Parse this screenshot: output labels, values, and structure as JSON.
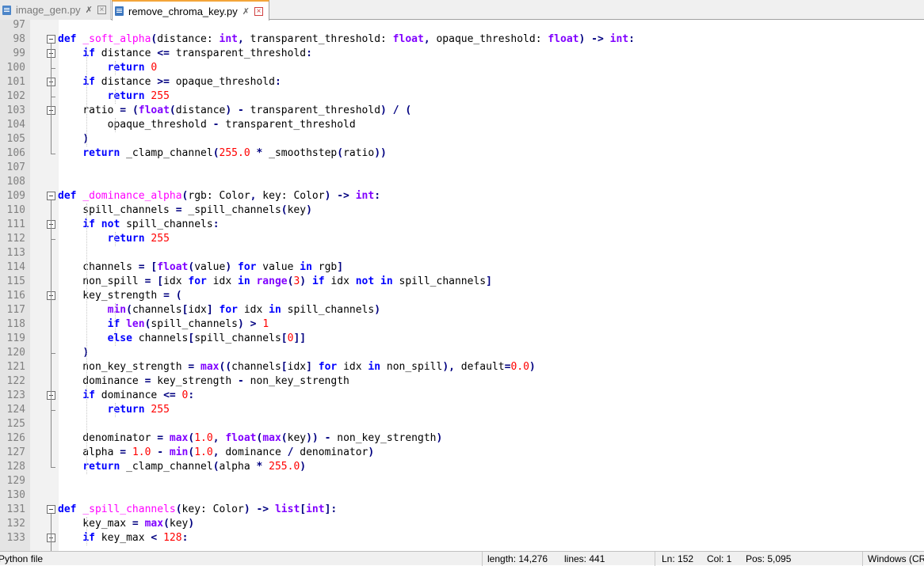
{
  "tabs": [
    {
      "label": "image_gen.py",
      "active": false
    },
    {
      "label": "remove_chroma_key.py",
      "active": true
    }
  ],
  "colors": {
    "keyword": "#0000ff",
    "builtin": "#8000ff",
    "function_name": "#ff00ff",
    "number": "#ff0000",
    "operator": "#000080"
  },
  "code_lines": [
    {
      "n": "97",
      "tokens": []
    },
    {
      "n": "98",
      "tokens": [
        [
          "kw",
          "def"
        ],
        [
          "t",
          " "
        ],
        [
          "fn",
          "_soft_alpha"
        ],
        [
          "op",
          "("
        ],
        [
          "t",
          "distance: "
        ],
        [
          "kw2",
          "int"
        ],
        [
          "op",
          ","
        ],
        [
          "t",
          " transparent_threshold: "
        ],
        [
          "kw2",
          "float"
        ],
        [
          "op",
          ","
        ],
        [
          "t",
          " opaque_threshold: "
        ],
        [
          "kw2",
          "float"
        ],
        [
          "op",
          ")"
        ],
        [
          "t",
          " "
        ],
        [
          "op",
          "->"
        ],
        [
          "t",
          " "
        ],
        [
          "kw2",
          "int"
        ],
        [
          "op",
          ":"
        ]
      ]
    },
    {
      "n": "99",
      "tokens": [
        [
          "t",
          "    "
        ],
        [
          "kw",
          "if"
        ],
        [
          "t",
          " distance "
        ],
        [
          "op",
          "<="
        ],
        [
          "t",
          " transparent_threshold"
        ],
        [
          "op",
          ":"
        ]
      ]
    },
    {
      "n": "100",
      "tokens": [
        [
          "t",
          "        "
        ],
        [
          "kw",
          "return"
        ],
        [
          "t",
          " "
        ],
        [
          "num",
          "0"
        ]
      ]
    },
    {
      "n": "101",
      "tokens": [
        [
          "t",
          "    "
        ],
        [
          "kw",
          "if"
        ],
        [
          "t",
          " distance "
        ],
        [
          "op",
          ">="
        ],
        [
          "t",
          " opaque_threshold"
        ],
        [
          "op",
          ":"
        ]
      ]
    },
    {
      "n": "102",
      "tokens": [
        [
          "t",
          "        "
        ],
        [
          "kw",
          "return"
        ],
        [
          "t",
          " "
        ],
        [
          "num",
          "255"
        ]
      ]
    },
    {
      "n": "103",
      "tokens": [
        [
          "t",
          "    ratio "
        ],
        [
          "op",
          "="
        ],
        [
          "t",
          " "
        ],
        [
          "op",
          "("
        ],
        [
          "kw2",
          "float"
        ],
        [
          "op",
          "("
        ],
        [
          "t",
          "distance"
        ],
        [
          "op",
          ")"
        ],
        [
          "t",
          " "
        ],
        [
          "op",
          "-"
        ],
        [
          "t",
          " transparent_threshold"
        ],
        [
          "op",
          ")"
        ],
        [
          "t",
          " "
        ],
        [
          "op",
          "/"
        ],
        [
          "t",
          " "
        ],
        [
          "op",
          "("
        ]
      ]
    },
    {
      "n": "104",
      "tokens": [
        [
          "t",
          "        opaque_threshold "
        ],
        [
          "op",
          "-"
        ],
        [
          "t",
          " transparent_threshold"
        ]
      ]
    },
    {
      "n": "105",
      "tokens": [
        [
          "t",
          "    "
        ],
        [
          "op",
          ")"
        ]
      ]
    },
    {
      "n": "106",
      "tokens": [
        [
          "t",
          "    "
        ],
        [
          "kw",
          "return"
        ],
        [
          "t",
          " _clamp_channel"
        ],
        [
          "op",
          "("
        ],
        [
          "num",
          "255.0"
        ],
        [
          "t",
          " "
        ],
        [
          "op",
          "*"
        ],
        [
          "t",
          " _smoothstep"
        ],
        [
          "op",
          "("
        ],
        [
          "t",
          "ratio"
        ],
        [
          "op",
          "))"
        ]
      ]
    },
    {
      "n": "107",
      "tokens": []
    },
    {
      "n": "108",
      "tokens": []
    },
    {
      "n": "109",
      "tokens": [
        [
          "kw",
          "def"
        ],
        [
          "t",
          " "
        ],
        [
          "fn",
          "_dominance_alpha"
        ],
        [
          "op",
          "("
        ],
        [
          "t",
          "rgb: Color"
        ],
        [
          "op",
          ","
        ],
        [
          "t",
          " key: Color"
        ],
        [
          "op",
          ")"
        ],
        [
          "t",
          " "
        ],
        [
          "op",
          "->"
        ],
        [
          "t",
          " "
        ],
        [
          "kw2",
          "int"
        ],
        [
          "op",
          ":"
        ]
      ]
    },
    {
      "n": "110",
      "tokens": [
        [
          "t",
          "    spill_channels "
        ],
        [
          "op",
          "="
        ],
        [
          "t",
          " _spill_channels"
        ],
        [
          "op",
          "("
        ],
        [
          "t",
          "key"
        ],
        [
          "op",
          ")"
        ]
      ]
    },
    {
      "n": "111",
      "tokens": [
        [
          "t",
          "    "
        ],
        [
          "kw",
          "if"
        ],
        [
          "t",
          " "
        ],
        [
          "kw",
          "not"
        ],
        [
          "t",
          " spill_channels"
        ],
        [
          "op",
          ":"
        ]
      ]
    },
    {
      "n": "112",
      "tokens": [
        [
          "t",
          "        "
        ],
        [
          "kw",
          "return"
        ],
        [
          "t",
          " "
        ],
        [
          "num",
          "255"
        ]
      ]
    },
    {
      "n": "113",
      "tokens": []
    },
    {
      "n": "114",
      "tokens": [
        [
          "t",
          "    channels "
        ],
        [
          "op",
          "="
        ],
        [
          "t",
          " "
        ],
        [
          "op",
          "["
        ],
        [
          "kw2",
          "float"
        ],
        [
          "op",
          "("
        ],
        [
          "t",
          "value"
        ],
        [
          "op",
          ")"
        ],
        [
          "t",
          " "
        ],
        [
          "kw",
          "for"
        ],
        [
          "t",
          " value "
        ],
        [
          "kw",
          "in"
        ],
        [
          "t",
          " rgb"
        ],
        [
          "op",
          "]"
        ]
      ]
    },
    {
      "n": "115",
      "tokens": [
        [
          "t",
          "    non_spill "
        ],
        [
          "op",
          "="
        ],
        [
          "t",
          " "
        ],
        [
          "op",
          "["
        ],
        [
          "t",
          "idx "
        ],
        [
          "kw",
          "for"
        ],
        [
          "t",
          " idx "
        ],
        [
          "kw",
          "in"
        ],
        [
          "t",
          " "
        ],
        [
          "kw2",
          "range"
        ],
        [
          "op",
          "("
        ],
        [
          "num",
          "3"
        ],
        [
          "op",
          ")"
        ],
        [
          "t",
          " "
        ],
        [
          "kw",
          "if"
        ],
        [
          "t",
          " idx "
        ],
        [
          "kw",
          "not"
        ],
        [
          "t",
          " "
        ],
        [
          "kw",
          "in"
        ],
        [
          "t",
          " spill_channels"
        ],
        [
          "op",
          "]"
        ]
      ]
    },
    {
      "n": "116",
      "tokens": [
        [
          "t",
          "    key_strength "
        ],
        [
          "op",
          "="
        ],
        [
          "t",
          " "
        ],
        [
          "op",
          "("
        ]
      ]
    },
    {
      "n": "117",
      "tokens": [
        [
          "t",
          "        "
        ],
        [
          "kw2",
          "min"
        ],
        [
          "op",
          "("
        ],
        [
          "t",
          "channels"
        ],
        [
          "op",
          "["
        ],
        [
          "t",
          "idx"
        ],
        [
          "op",
          "]"
        ],
        [
          "t",
          " "
        ],
        [
          "kw",
          "for"
        ],
        [
          "t",
          " idx "
        ],
        [
          "kw",
          "in"
        ],
        [
          "t",
          " spill_channels"
        ],
        [
          "op",
          ")"
        ]
      ]
    },
    {
      "n": "118",
      "tokens": [
        [
          "t",
          "        "
        ],
        [
          "kw",
          "if"
        ],
        [
          "t",
          " "
        ],
        [
          "kw2",
          "len"
        ],
        [
          "op",
          "("
        ],
        [
          "t",
          "spill_channels"
        ],
        [
          "op",
          ")"
        ],
        [
          "t",
          " "
        ],
        [
          "op",
          ">"
        ],
        [
          "t",
          " "
        ],
        [
          "num",
          "1"
        ]
      ]
    },
    {
      "n": "119",
      "tokens": [
        [
          "t",
          "        "
        ],
        [
          "kw",
          "else"
        ],
        [
          "t",
          " channels"
        ],
        [
          "op",
          "["
        ],
        [
          "t",
          "spill_channels"
        ],
        [
          "op",
          "["
        ],
        [
          "num",
          "0"
        ],
        [
          "op",
          "]]"
        ]
      ]
    },
    {
      "n": "120",
      "tokens": [
        [
          "t",
          "    "
        ],
        [
          "op",
          ")"
        ]
      ]
    },
    {
      "n": "121",
      "tokens": [
        [
          "t",
          "    non_key_strength "
        ],
        [
          "op",
          "="
        ],
        [
          "t",
          " "
        ],
        [
          "kw2",
          "max"
        ],
        [
          "op",
          "(("
        ],
        [
          "t",
          "channels"
        ],
        [
          "op",
          "["
        ],
        [
          "t",
          "idx"
        ],
        [
          "op",
          "]"
        ],
        [
          "t",
          " "
        ],
        [
          "kw",
          "for"
        ],
        [
          "t",
          " idx "
        ],
        [
          "kw",
          "in"
        ],
        [
          "t",
          " non_spill"
        ],
        [
          "op",
          "),"
        ],
        [
          "t",
          " default"
        ],
        [
          "op",
          "="
        ],
        [
          "num",
          "0.0"
        ],
        [
          "op",
          ")"
        ]
      ]
    },
    {
      "n": "122",
      "tokens": [
        [
          "t",
          "    dominance "
        ],
        [
          "op",
          "="
        ],
        [
          "t",
          " key_strength "
        ],
        [
          "op",
          "-"
        ],
        [
          "t",
          " non_key_strength"
        ]
      ]
    },
    {
      "n": "123",
      "tokens": [
        [
          "t",
          "    "
        ],
        [
          "kw",
          "if"
        ],
        [
          "t",
          " dominance "
        ],
        [
          "op",
          "<="
        ],
        [
          "t",
          " "
        ],
        [
          "num",
          "0"
        ],
        [
          "op",
          ":"
        ]
      ]
    },
    {
      "n": "124",
      "tokens": [
        [
          "t",
          "        "
        ],
        [
          "kw",
          "return"
        ],
        [
          "t",
          " "
        ],
        [
          "num",
          "255"
        ]
      ]
    },
    {
      "n": "125",
      "tokens": []
    },
    {
      "n": "126",
      "tokens": [
        [
          "t",
          "    denominator "
        ],
        [
          "op",
          "="
        ],
        [
          "t",
          " "
        ],
        [
          "kw2",
          "max"
        ],
        [
          "op",
          "("
        ],
        [
          "num",
          "1.0"
        ],
        [
          "op",
          ","
        ],
        [
          "t",
          " "
        ],
        [
          "kw2",
          "float"
        ],
        [
          "op",
          "("
        ],
        [
          "kw2",
          "max"
        ],
        [
          "op",
          "("
        ],
        [
          "t",
          "key"
        ],
        [
          "op",
          "))"
        ],
        [
          "t",
          " "
        ],
        [
          "op",
          "-"
        ],
        [
          "t",
          " non_key_strength"
        ],
        [
          "op",
          ")"
        ]
      ]
    },
    {
      "n": "127",
      "tokens": [
        [
          "t",
          "    alpha "
        ],
        [
          "op",
          "="
        ],
        [
          "t",
          " "
        ],
        [
          "num",
          "1.0"
        ],
        [
          "t",
          " "
        ],
        [
          "op",
          "-"
        ],
        [
          "t",
          " "
        ],
        [
          "kw2",
          "min"
        ],
        [
          "op",
          "("
        ],
        [
          "num",
          "1.0"
        ],
        [
          "op",
          ","
        ],
        [
          "t",
          " dominance "
        ],
        [
          "op",
          "/"
        ],
        [
          "t",
          " denominator"
        ],
        [
          "op",
          ")"
        ]
      ]
    },
    {
      "n": "128",
      "tokens": [
        [
          "t",
          "    "
        ],
        [
          "kw",
          "return"
        ],
        [
          "t",
          " _clamp_channel"
        ],
        [
          "op",
          "("
        ],
        [
          "t",
          "alpha "
        ],
        [
          "op",
          "*"
        ],
        [
          "t",
          " "
        ],
        [
          "num",
          "255.0"
        ],
        [
          "op",
          ")"
        ]
      ]
    },
    {
      "n": "129",
      "tokens": []
    },
    {
      "n": "130",
      "tokens": []
    },
    {
      "n": "131",
      "tokens": [
        [
          "kw",
          "def"
        ],
        [
          "t",
          " "
        ],
        [
          "fn",
          "_spill_channels"
        ],
        [
          "op",
          "("
        ],
        [
          "t",
          "key: Color"
        ],
        [
          "op",
          ")"
        ],
        [
          "t",
          " "
        ],
        [
          "op",
          "->"
        ],
        [
          "t",
          " "
        ],
        [
          "kw2",
          "list"
        ],
        [
          "op",
          "["
        ],
        [
          "kw2",
          "int"
        ],
        [
          "op",
          "]:"
        ]
      ]
    },
    {
      "n": "132",
      "tokens": [
        [
          "t",
          "    key_max "
        ],
        [
          "op",
          "="
        ],
        [
          "t",
          " "
        ],
        [
          "kw2",
          "max"
        ],
        [
          "op",
          "("
        ],
        [
          "t",
          "key"
        ],
        [
          "op",
          ")"
        ]
      ]
    },
    {
      "n": "133",
      "tokens": [
        [
          "t",
          "    "
        ],
        [
          "kw",
          "if"
        ],
        [
          "t",
          " key_max "
        ],
        [
          "op",
          "<"
        ],
        [
          "t",
          " "
        ],
        [
          "num",
          "128"
        ],
        [
          "op",
          ":"
        ]
      ]
    }
  ],
  "status": {
    "file_type": "Python file",
    "length": "length: 14,276",
    "lines": "lines: 441",
    "ln": "Ln: 152",
    "col": "Col: 1",
    "pos": "Pos: 5,095",
    "eol": "Windows (CR LF)"
  }
}
